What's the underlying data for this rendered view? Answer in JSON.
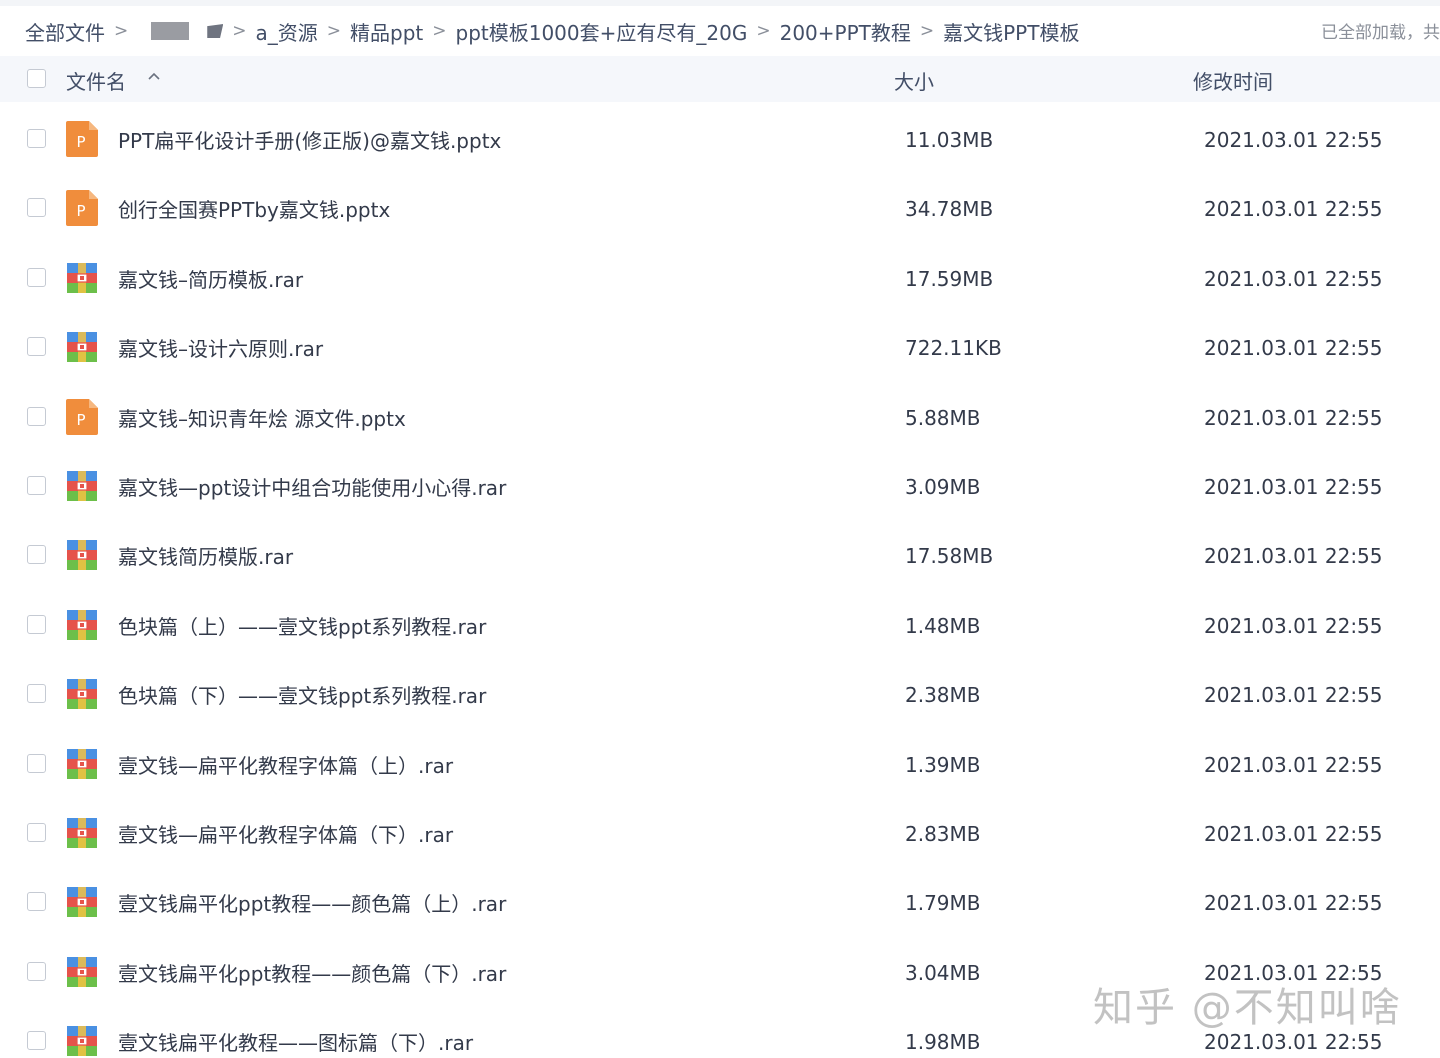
{
  "breadcrumb": {
    "root": "全部文件",
    "items": [
      "a_资源",
      "精品ppt",
      "ppt模板1000套+应有尽有_20G",
      "200+PPT教程",
      "嘉文钱PPT模板"
    ],
    "separator": ">"
  },
  "status_text": "已全部加载，共",
  "columns": {
    "name": "文件名",
    "size": "大小",
    "time": "修改时间"
  },
  "files": [
    {
      "name": "PPT扁平化设计手册(修正版)@嘉文钱.pptx",
      "size": "11.03MB",
      "time": "2021.03.01 22:55",
      "type": "pptx"
    },
    {
      "name": "创行全国赛PPTby嘉文钱.pptx",
      "size": "34.78MB",
      "time": "2021.03.01 22:55",
      "type": "pptx"
    },
    {
      "name": "嘉文钱–简历模板.rar",
      "size": "17.59MB",
      "time": "2021.03.01 22:55",
      "type": "rar"
    },
    {
      "name": "嘉文钱–设计六原则.rar",
      "size": "722.11KB",
      "time": "2021.03.01 22:55",
      "type": "rar"
    },
    {
      "name": "嘉文钱–知识青年烩 源文件.pptx",
      "size": "5.88MB",
      "time": "2021.03.01 22:55",
      "type": "pptx"
    },
    {
      "name": "嘉文钱—ppt设计中组合功能使用小心得.rar",
      "size": "3.09MB",
      "time": "2021.03.01 22:55",
      "type": "rar"
    },
    {
      "name": "嘉文钱简历模版.rar",
      "size": "17.58MB",
      "time": "2021.03.01 22:55",
      "type": "rar"
    },
    {
      "name": "色块篇（上）——壹文钱ppt系列教程.rar",
      "size": "1.48MB",
      "time": "2021.03.01 22:55",
      "type": "rar"
    },
    {
      "name": "色块篇（下）——壹文钱ppt系列教程.rar",
      "size": "2.38MB",
      "time": "2021.03.01 22:55",
      "type": "rar"
    },
    {
      "name": "壹文钱—扁平化教程字体篇（上）.rar",
      "size": "1.39MB",
      "time": "2021.03.01 22:55",
      "type": "rar"
    },
    {
      "name": "壹文钱—扁平化教程字体篇（下）.rar",
      "size": "2.83MB",
      "time": "2021.03.01 22:55",
      "type": "rar"
    },
    {
      "name": "壹文钱扁平化ppt教程——颜色篇（上）.rar",
      "size": "1.79MB",
      "time": "2021.03.01 22:55",
      "type": "rar"
    },
    {
      "name": "壹文钱扁平化ppt教程——颜色篇（下）.rar",
      "size": "3.04MB",
      "time": "2021.03.01 22:55",
      "type": "rar"
    },
    {
      "name": "壹文钱扁平化教程——图标篇（下）.rar",
      "size": "1.98MB",
      "time": "2021.03.01 22:55",
      "type": "rar"
    }
  ],
  "watermark": "知乎 @不知叫啥",
  "colors": {
    "header_bg": "#f5f7fb",
    "text": "#333a4a",
    "pptx_icon": "#f08d3c",
    "rar_blue": "#4a90e2",
    "rar_red": "#e5534b",
    "rar_green": "#6cbf4a",
    "rar_yellow": "#f5c242"
  },
  "icons": {
    "pptx": "pptx-file-icon",
    "rar": "rar-archive-icon",
    "sort": "sort-ascending-icon"
  }
}
